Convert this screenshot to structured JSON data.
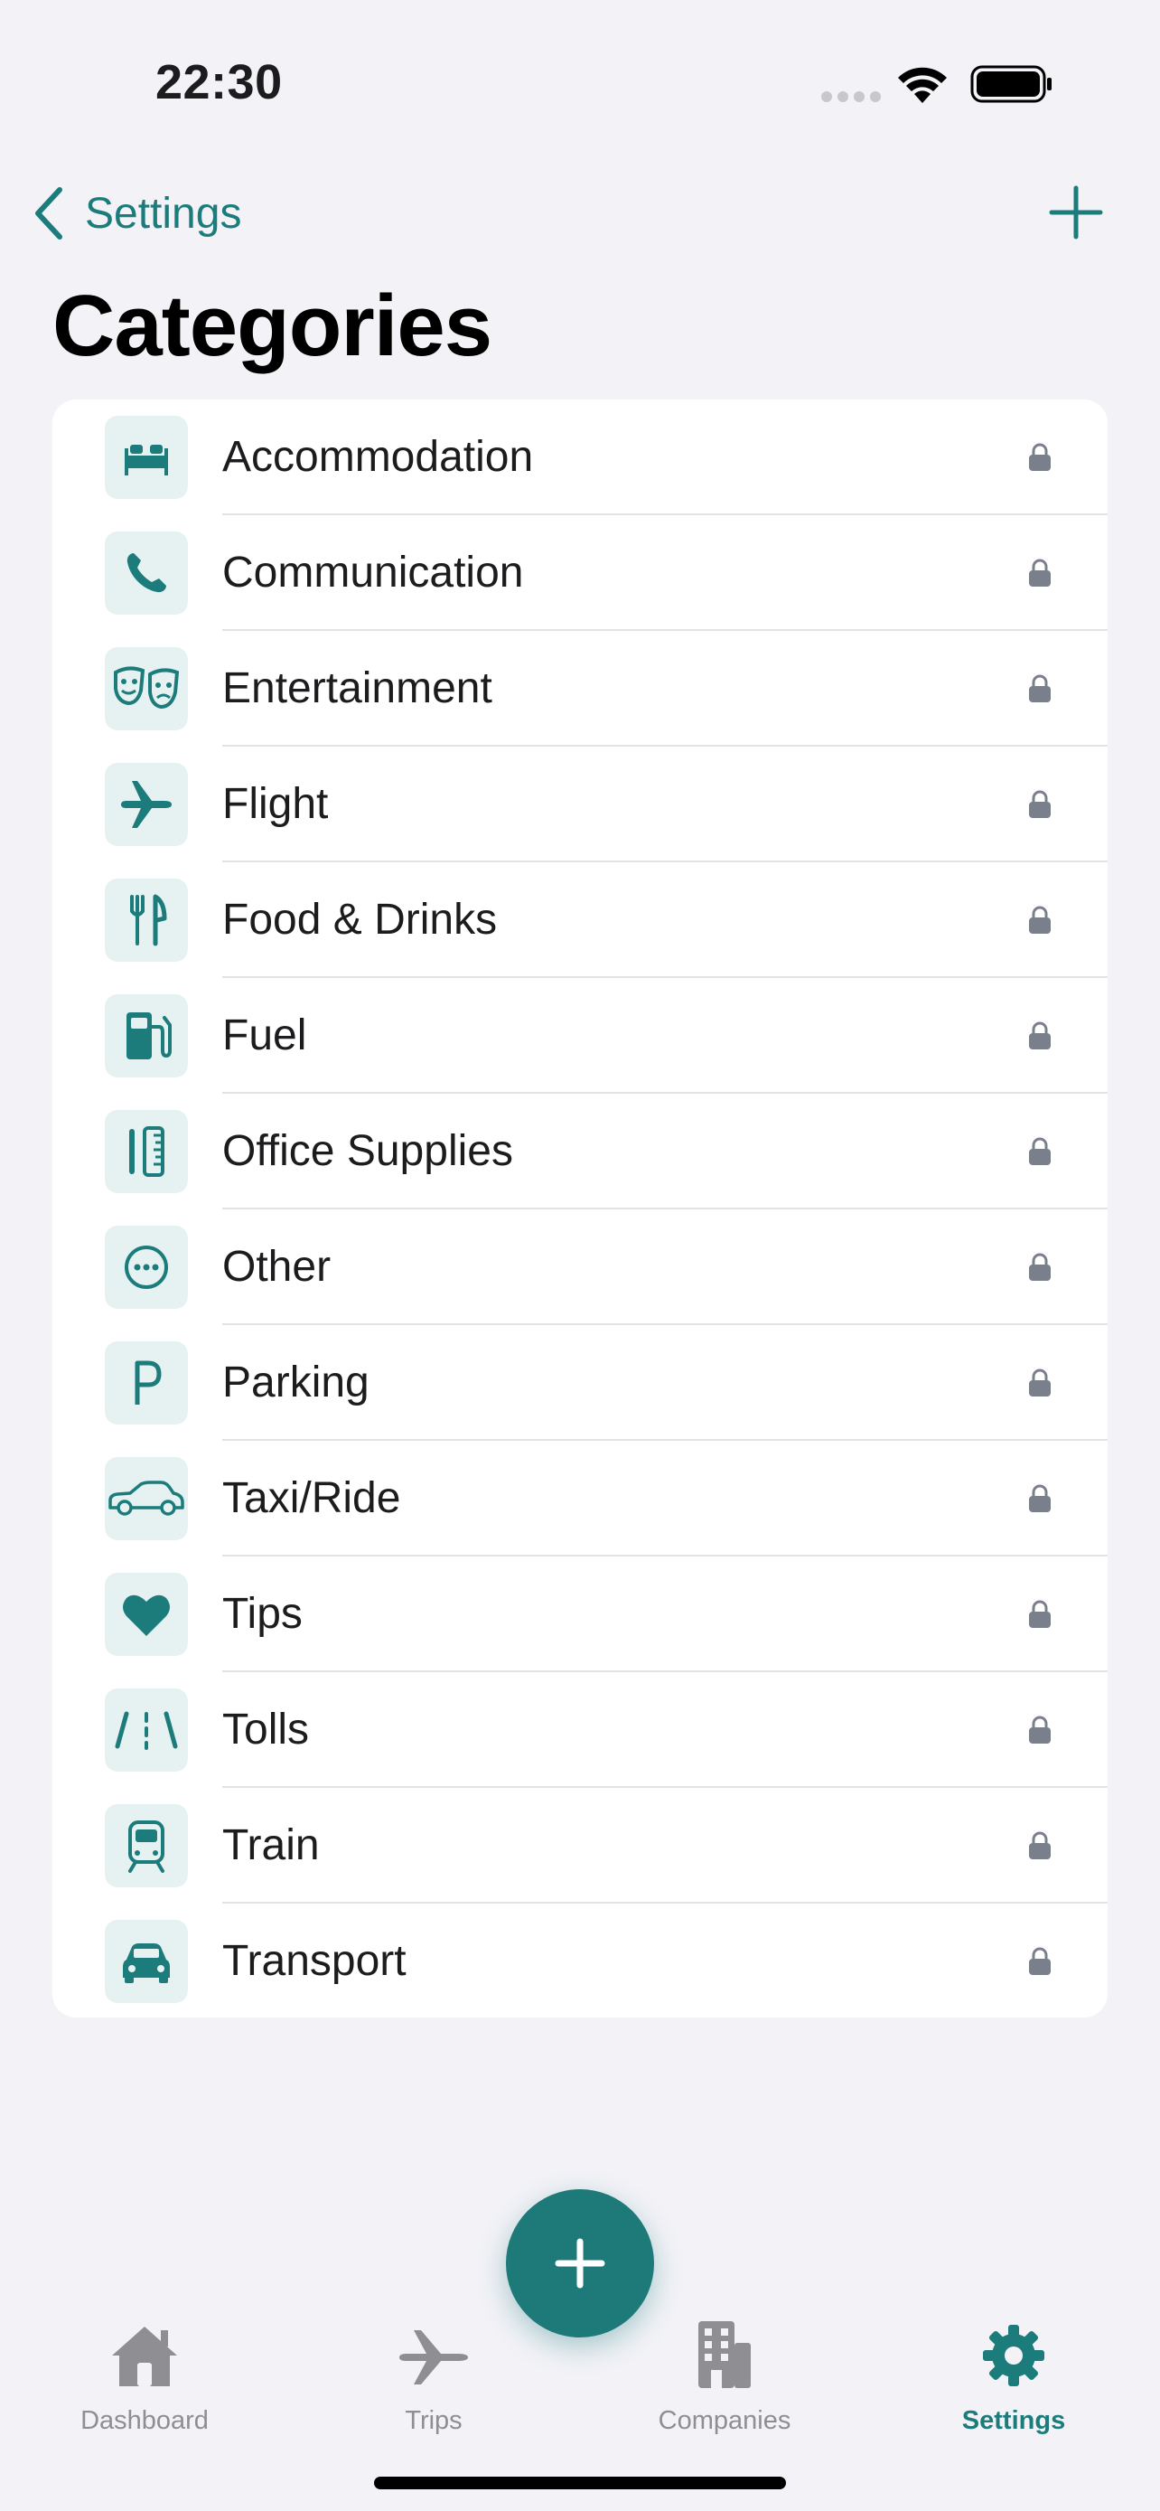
{
  "status_bar": {
    "time": "22:30"
  },
  "nav": {
    "back_label": "Settings"
  },
  "page": {
    "title": "Categories"
  },
  "categories": [
    {
      "label": "Accommodation",
      "icon": "bed-icon"
    },
    {
      "label": "Communication",
      "icon": "phone-icon"
    },
    {
      "label": "Entertainment",
      "icon": "theater-masks-icon"
    },
    {
      "label": "Flight",
      "icon": "airplane-icon"
    },
    {
      "label": "Food & Drinks",
      "icon": "fork-knife-icon"
    },
    {
      "label": "Fuel",
      "icon": "fuel-pump-icon"
    },
    {
      "label": "Office Supplies",
      "icon": "pencil-ruler-icon"
    },
    {
      "label": "Other",
      "icon": "ellipsis-circle-icon"
    },
    {
      "label": "Parking",
      "icon": "parking-p-icon"
    },
    {
      "label": "Taxi/Ride",
      "icon": "car-side-icon"
    },
    {
      "label": "Tips",
      "icon": "heart-icon"
    },
    {
      "label": "Tolls",
      "icon": "road-lanes-icon"
    },
    {
      "label": "Train",
      "icon": "tram-icon"
    },
    {
      "label": "Transport",
      "icon": "car-front-icon"
    }
  ],
  "tab_bar": {
    "tabs": [
      {
        "label": "Dashboard",
        "icon": "house-icon",
        "active": false
      },
      {
        "label": "Trips",
        "icon": "airplane-icon",
        "active": false
      },
      {
        "label": "Companies",
        "icon": "building-icon",
        "active": false
      },
      {
        "label": "Settings",
        "icon": "gear-icon",
        "active": true
      }
    ]
  },
  "colors": {
    "accent": "#1c7c7b",
    "icon_tile": "#e6f1f1",
    "background": "#f2f2f7",
    "lock": "#7a808b",
    "inactive_tab": "#8e8e93"
  }
}
